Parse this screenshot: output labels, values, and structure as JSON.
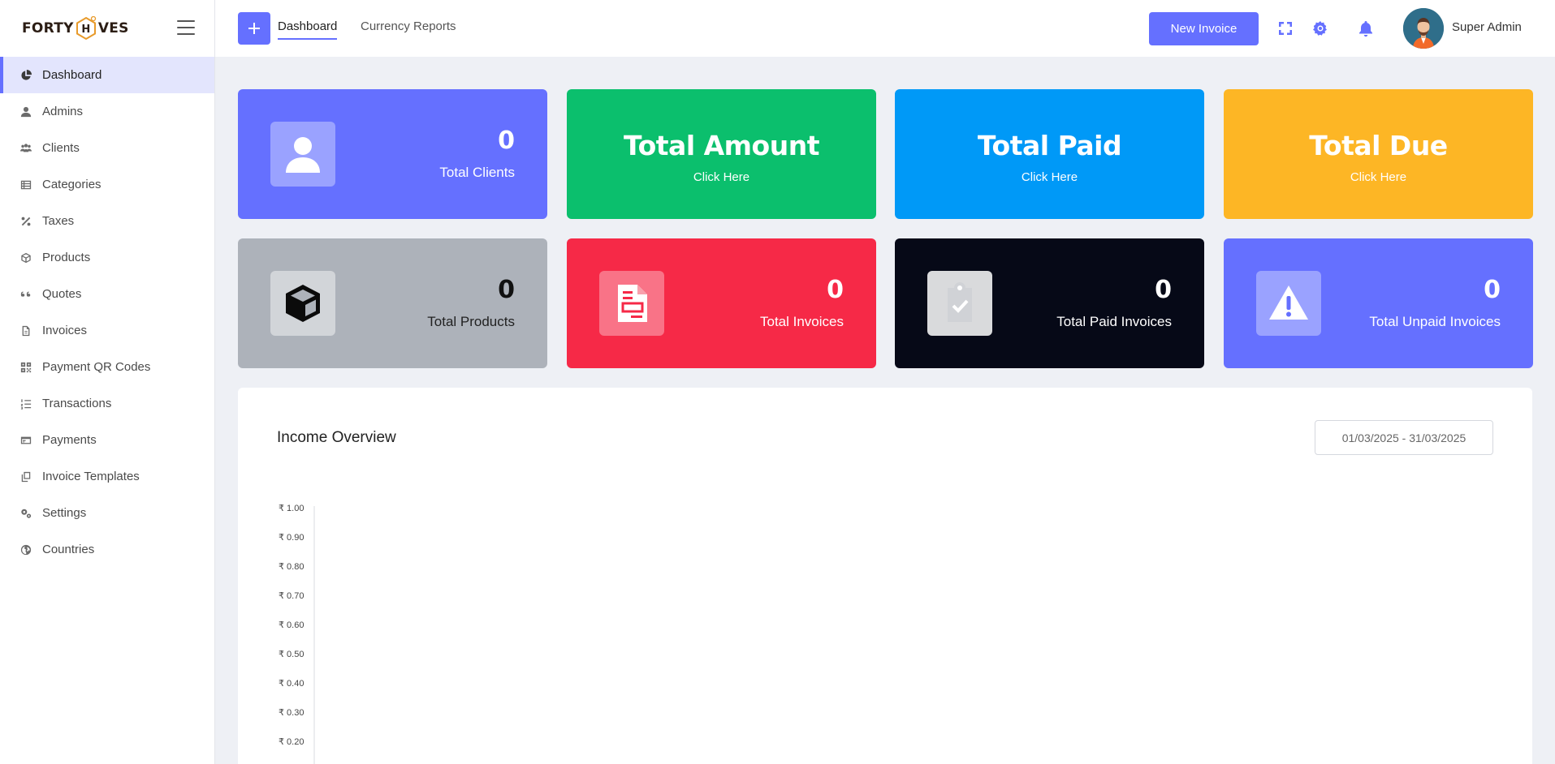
{
  "sidebar": {
    "logo": {
      "part1": "FORTY",
      "part2": "H",
      "part3": "VES"
    },
    "items": [
      {
        "label": "Dashboard",
        "icon": "chart-pie-icon"
      },
      {
        "label": "Admins",
        "icon": "user-icon"
      },
      {
        "label": "Clients",
        "icon": "users-icon"
      },
      {
        "label": "Categories",
        "icon": "table-list-icon"
      },
      {
        "label": "Taxes",
        "icon": "percent-icon"
      },
      {
        "label": "Products",
        "icon": "cube-icon"
      },
      {
        "label": "Quotes",
        "icon": "quote-icon"
      },
      {
        "label": "Invoices",
        "icon": "file-icon"
      },
      {
        "label": "Payment QR Codes",
        "icon": "qrcode-icon"
      },
      {
        "label": "Transactions",
        "icon": "list-ol-icon"
      },
      {
        "label": "Payments",
        "icon": "credit-card-icon"
      },
      {
        "label": "Invoice Templates",
        "icon": "copy-icon"
      },
      {
        "label": "Settings",
        "icon": "gears-icon"
      },
      {
        "label": "Countries",
        "icon": "globe-icon"
      }
    ]
  },
  "header": {
    "tabs": [
      {
        "label": "Dashboard"
      },
      {
        "label": "Currency Reports"
      }
    ],
    "new_invoice_label": "New Invoice",
    "user_name": "Super Admin"
  },
  "cards": {
    "total_clients": {
      "value": "0",
      "label": "Total Clients"
    },
    "total_amount": {
      "title": "Total Amount",
      "link": "Click Here"
    },
    "total_paid": {
      "title": "Total Paid",
      "link": "Click Here"
    },
    "total_due": {
      "title": "Total Due",
      "link": "Click Here"
    },
    "total_products": {
      "value": "0",
      "label": "Total Products"
    },
    "total_invoices": {
      "value": "0",
      "label": "Total Invoices"
    },
    "total_paid_invoices": {
      "value": "0",
      "label": "Total Paid Invoices"
    },
    "total_unpaid_invoices": {
      "value": "0",
      "label": "Total Unpaid Invoices"
    }
  },
  "colors": {
    "accent": "#6570ff",
    "clients_card": "#6570ff",
    "amount_card": "#0bbf6d",
    "paid_card": "#0099f7",
    "due_card": "#fdb625",
    "products_card": "#adb2ba",
    "invoices_card": "#f62947",
    "paid_invoices_card": "#060917",
    "unpaid_invoices_card": "#6570ff"
  },
  "income": {
    "title": "Income Overview",
    "date_range": "01/03/2025 - 31/03/2025"
  },
  "chart_data": {
    "type": "line",
    "series": [],
    "y_ticks": [
      "₹ 1.00",
      "₹ 0.90",
      "₹ 0.80",
      "₹ 0.70",
      "₹ 0.60",
      "₹ 0.50",
      "₹ 0.40",
      "₹ 0.30",
      "₹ 0.20"
    ],
    "ylim": [
      0,
      1
    ],
    "grid": false
  }
}
